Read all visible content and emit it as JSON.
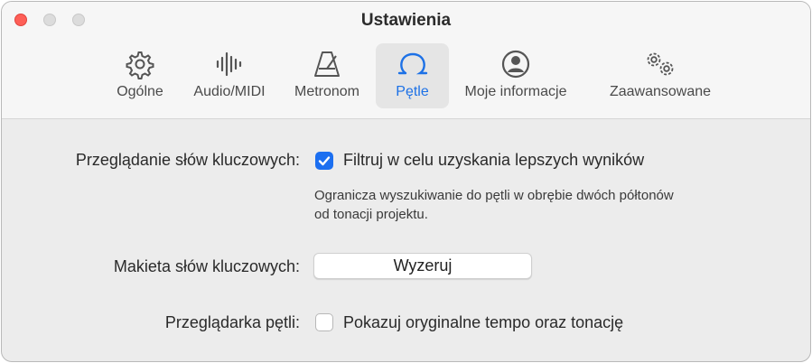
{
  "window": {
    "title": "Ustawienia"
  },
  "tabs": [
    {
      "label": "Ogólne",
      "icon": "gear-icon"
    },
    {
      "label": "Audio/MIDI",
      "icon": "waveform-icon"
    },
    {
      "label": "Metronom",
      "icon": "metronome-icon"
    },
    {
      "label": "Pętle",
      "icon": "loop-icon",
      "selected": true
    },
    {
      "label": "Moje informacje",
      "icon": "person-circle-icon"
    },
    {
      "label": "Zaawansowane",
      "icon": "gears-icon"
    }
  ],
  "settings": {
    "keyword_browsing": {
      "label": "Przeglądanie słów kluczowych:",
      "checkbox_label": "Filtruj w celu uzyskania lepszych wyników",
      "checked": true,
      "description_line1": "Ogranicza wyszukiwanie do pętli w obrębie dwóch półtonów",
      "description_line2": "od tonacji projektu."
    },
    "keyword_layout": {
      "label": "Makieta słów kluczowych:",
      "button_label": "Wyzeruj"
    },
    "loop_browser": {
      "label": "Przeglądarka pętli:",
      "checkbox_label": "Pokazuj oryginalne tempo oraz tonację",
      "checked": false
    }
  },
  "colors": {
    "accent": "#1c6ff0",
    "selected_tab_text": "#1d71e6",
    "close_button": "#fe5f57"
  }
}
